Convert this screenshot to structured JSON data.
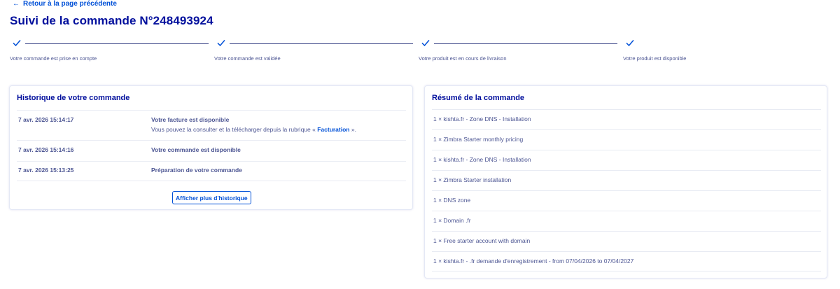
{
  "nav": {
    "back_arrow": "←",
    "back_label": "Retour à la page précédente"
  },
  "page_title": "Suivi de la commande N°248493924",
  "tracker": {
    "steps": [
      {
        "label": "Votre commande est prise en compte",
        "icon": "check-icon"
      },
      {
        "label": "Votre commande est validée",
        "icon": "check-icon"
      },
      {
        "label": "Votre produit est en cours de livraison",
        "icon": "check-icon"
      },
      {
        "label": "Votre produit est disponible",
        "icon": "check-icon"
      }
    ]
  },
  "history": {
    "title": "Historique de votre commande",
    "items": [
      {
        "date": "7 avr. 2026 15:14:17",
        "title": "Votre facture est disponible",
        "desc_before": "Vous pouvez la consulter et la télécharger depuis la rubrique « ",
        "desc_link": "Facturation",
        "desc_after": " »."
      },
      {
        "date": "7 avr. 2026 15:14:16",
        "title": "Votre commande est disponible"
      },
      {
        "date": "7 avr. 2026 15:13:25",
        "title": "Préparation de votre commande"
      }
    ],
    "more_button": "Afficher plus d'historique"
  },
  "summary": {
    "title": "Résumé de la commande",
    "items": [
      "1 × kishta.fr - Zone DNS - Installation",
      "1 × Zimbra Starter monthly pricing",
      "1 × kishta.fr - Zone DNS - Installation",
      "1 × Zimbra Starter installation",
      "1 × DNS zone",
      "1 × Domain .fr",
      "1 × Free starter account with domain",
      "1 × kishta.fr - .fr demande d'enregistrement - from 07/04/2026 to 07/04/2027"
    ]
  },
  "colors": {
    "title": "#000e9c",
    "text": "#4d5693",
    "accent": "#0050d7",
    "divider": "#e8ebf3"
  }
}
